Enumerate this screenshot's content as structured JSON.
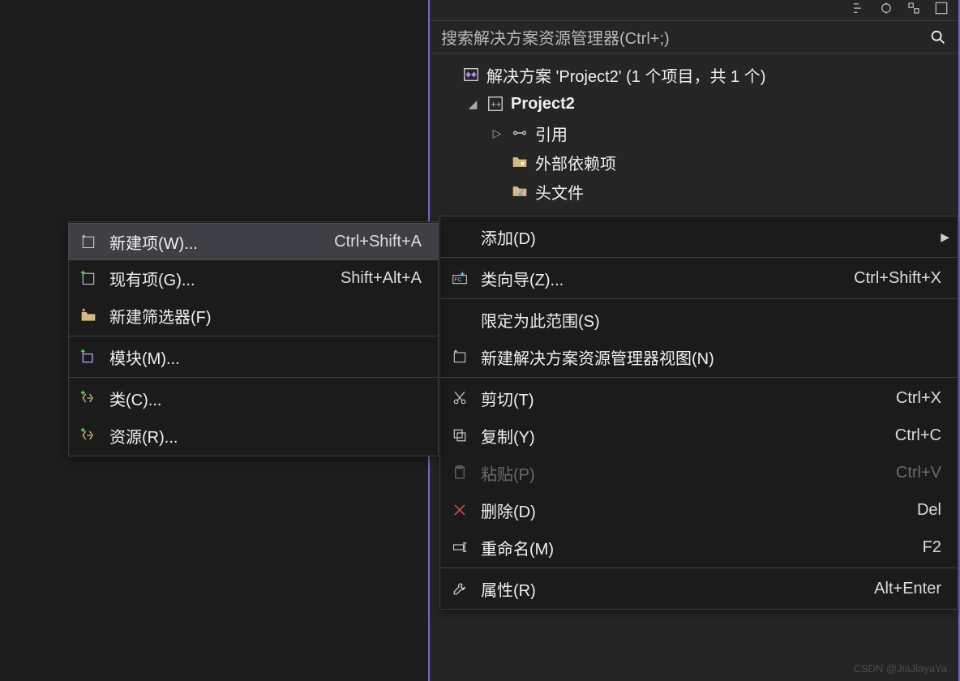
{
  "panel": {
    "search_placeholder": "搜索解决方案资源管理器(Ctrl+;)",
    "solution_label": "解决方案 'Project2' (1 个项目，共 1 个)",
    "nodes": {
      "project": "Project2",
      "refs": "引用",
      "ext": "外部依赖项",
      "headers": "头文件"
    }
  },
  "ctx": {
    "add": "添加(D)",
    "classwizard": "类向导(Z)...",
    "classwizard_sc": "Ctrl+Shift+X",
    "scope": "限定为此范围(S)",
    "newview": "新建解决方案资源管理器视图(N)",
    "cut": "剪切(T)",
    "cut_sc": "Ctrl+X",
    "copy": "复制(Y)",
    "copy_sc": "Ctrl+C",
    "paste": "粘贴(P)",
    "paste_sc": "Ctrl+V",
    "del": "删除(D)",
    "del_sc": "Del",
    "rename": "重命名(M)",
    "rename_sc": "F2",
    "props": "属性(R)",
    "props_sc": "Alt+Enter"
  },
  "submenu": {
    "newitem": "新建项(W)...",
    "newitem_sc": "Ctrl+Shift+A",
    "existitem": "现有项(G)...",
    "existitem_sc": "Shift+Alt+A",
    "filter": "新建筛选器(F)",
    "module": "模块(M)...",
    "class": "类(C)...",
    "resource": "资源(R)..."
  },
  "watermark": "CSDN @JiaJiayaYa"
}
